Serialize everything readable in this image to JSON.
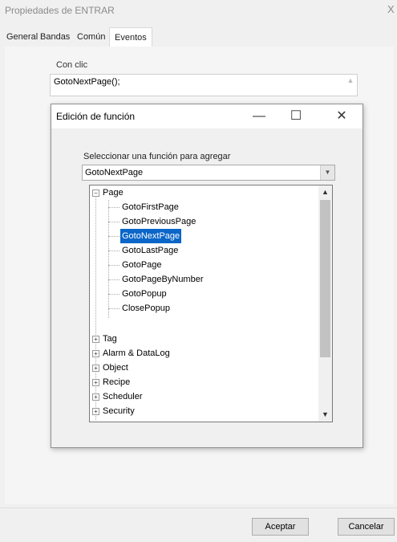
{
  "outer_window": {
    "title": "Propiedades de ENTRAR",
    "close_glyph": "X"
  },
  "tabs": [
    {
      "label": "General"
    },
    {
      "label": "Bandas"
    },
    {
      "label": "Común"
    },
    {
      "label": "Eventos",
      "active": true
    }
  ],
  "events": {
    "on_click_label": "Con clic",
    "on_click_value": "GotoNextPage();"
  },
  "dialog": {
    "title": "Edición de función",
    "minimize_glyph": "—",
    "maximize_glyph": "☐",
    "close_glyph": "✕",
    "select_label": "Seleccionar una función para agregar",
    "combo_value": "GotoNextPage",
    "tree": {
      "page_group": {
        "label": "Page",
        "expanded": true,
        "children": [
          "GotoFirstPage",
          "GotoPreviousPage",
          "GotoNextPage",
          "GotoLastPage",
          "GotoPage",
          "GotoPageByNumber",
          "GotoPopup",
          "ClosePopup"
        ],
        "selected": "GotoNextPage"
      },
      "groups": [
        "Tag",
        "Alarm & DataLog",
        "Object",
        "Recipe",
        "Scheduler",
        "Security"
      ]
    }
  },
  "buttons": {
    "ok": "Aceptar",
    "cancel": "Cancelar"
  }
}
